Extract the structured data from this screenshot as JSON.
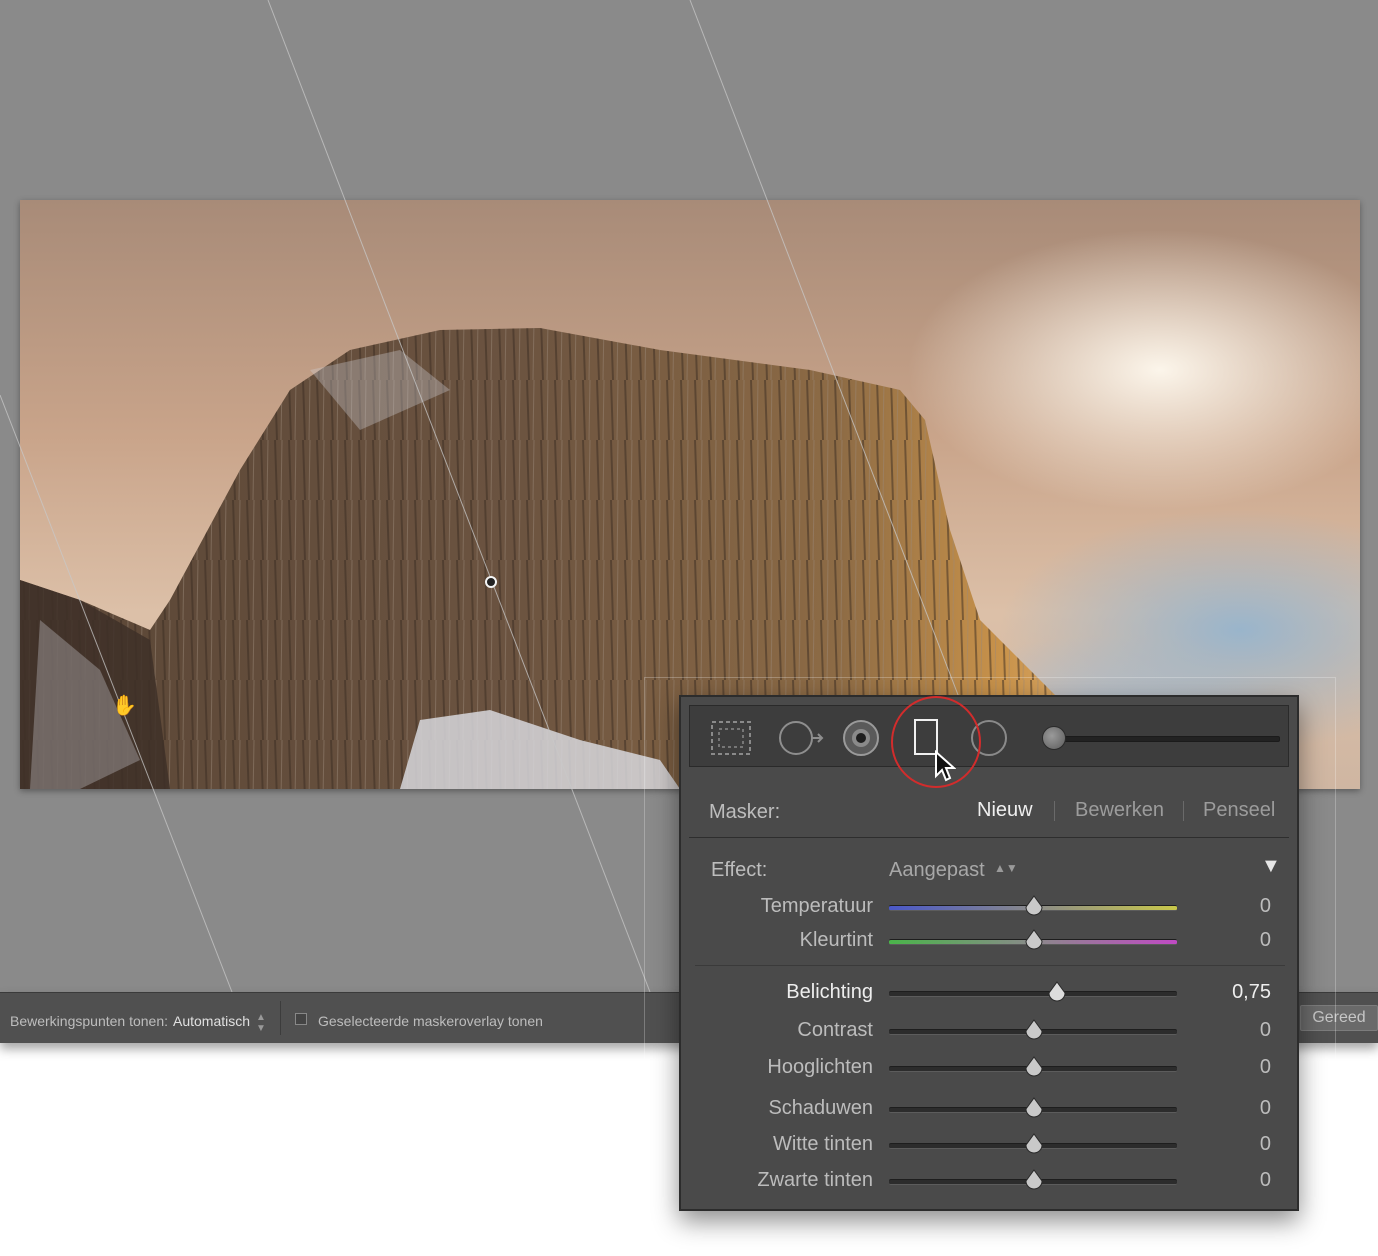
{
  "toolbar": {
    "edit_points_label": "Bewerkingspunten tonen:",
    "edit_points_value": "Automatisch",
    "overlay_label": "Geselecteerde maskeroverlay tonen",
    "done_label": "Gereed"
  },
  "panel": {
    "mask_label": "Masker:",
    "tabs": [
      {
        "label": "Nieuw",
        "active": true
      },
      {
        "label": "Bewerken",
        "active": false
      },
      {
        "label": "Penseel",
        "active": false
      }
    ],
    "effect_label": "Effect:",
    "effect_value": "Aangepast",
    "tools": [
      "crop-overlay-icon",
      "spot-removal-icon",
      "red-eye-icon",
      "graduated-filter-icon",
      "radial-filter-icon"
    ],
    "sliders_color": [
      {
        "label": "Temperatuur",
        "value": "0",
        "position": 0.5
      },
      {
        "label": "Kleurtint",
        "value": "0",
        "position": 0.5
      }
    ],
    "sliders_tone": [
      {
        "label": "Belichting",
        "value": "0,75",
        "position": 0.58,
        "highlight": true
      },
      {
        "label": "Contrast",
        "value": "0",
        "position": 0.5
      },
      {
        "label": "Hooglichten",
        "value": "0",
        "position": 0.5
      },
      {
        "label": "Schaduwen",
        "value": "0",
        "position": 0.5
      },
      {
        "label": "Witte tinten",
        "value": "0",
        "position": 0.5
      },
      {
        "label": "Zwarte tinten",
        "value": "0",
        "position": 0.5
      }
    ]
  },
  "colors": {
    "highlight_ring": "#d22c2c",
    "panel_bg": "#4a4a4a",
    "canvas_bg": "#8a8a8a"
  }
}
